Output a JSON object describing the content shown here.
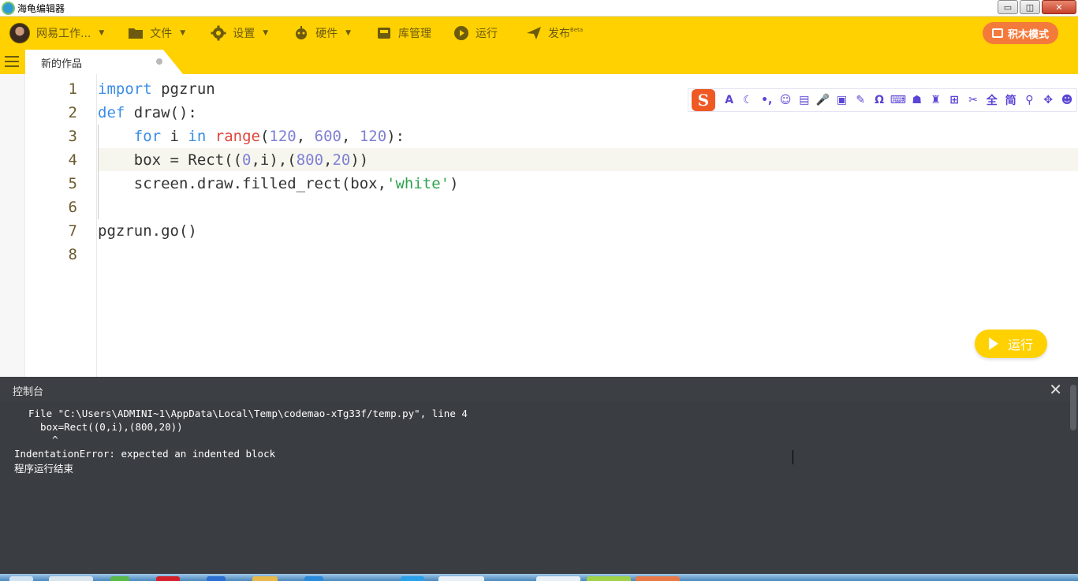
{
  "window": {
    "title": "海龟编辑器",
    "minimize": "▭",
    "restore": "◫",
    "close": "✕"
  },
  "toolbar": {
    "account_label": "网易工作...",
    "file_label": "文件",
    "settings_label": "设置",
    "hardware_label": "硬件",
    "library_label": "库管理",
    "run_label": "运行",
    "publish_label": "发布",
    "publish_sup": "Beta",
    "mode_label": "积木模式",
    "colors": {
      "bar": "#ffd100",
      "mode_button": "#f47a3b"
    }
  },
  "tab": {
    "label": "新的作品"
  },
  "editor": {
    "line_numbers": [
      "1",
      "2",
      "3",
      "4",
      "5",
      "6",
      "7",
      "8"
    ],
    "current_line": 4
  },
  "ime": {
    "logo": "S",
    "buttons": [
      "A",
      "☾",
      "•,",
      "☺",
      "▤",
      "🎤",
      "▣",
      "✎",
      "Ω",
      "⌨",
      "☗",
      "♜",
      "⊞",
      "✂",
      "全",
      "简",
      "⚲",
      "✥",
      "☻"
    ]
  },
  "run_button": {
    "label": "运行"
  },
  "console": {
    "title": "控制台",
    "close": "✕",
    "lines": [
      "File \"C:\\Users\\ADMINI~1\\AppData\\Local\\Temp\\codemao-xTg33f/temp.py\", line 4",
      "  box=Rect((0,i),(800,20))",
      "    ^",
      "IndentationError: expected an indented block",
      "程序运行结束"
    ]
  }
}
